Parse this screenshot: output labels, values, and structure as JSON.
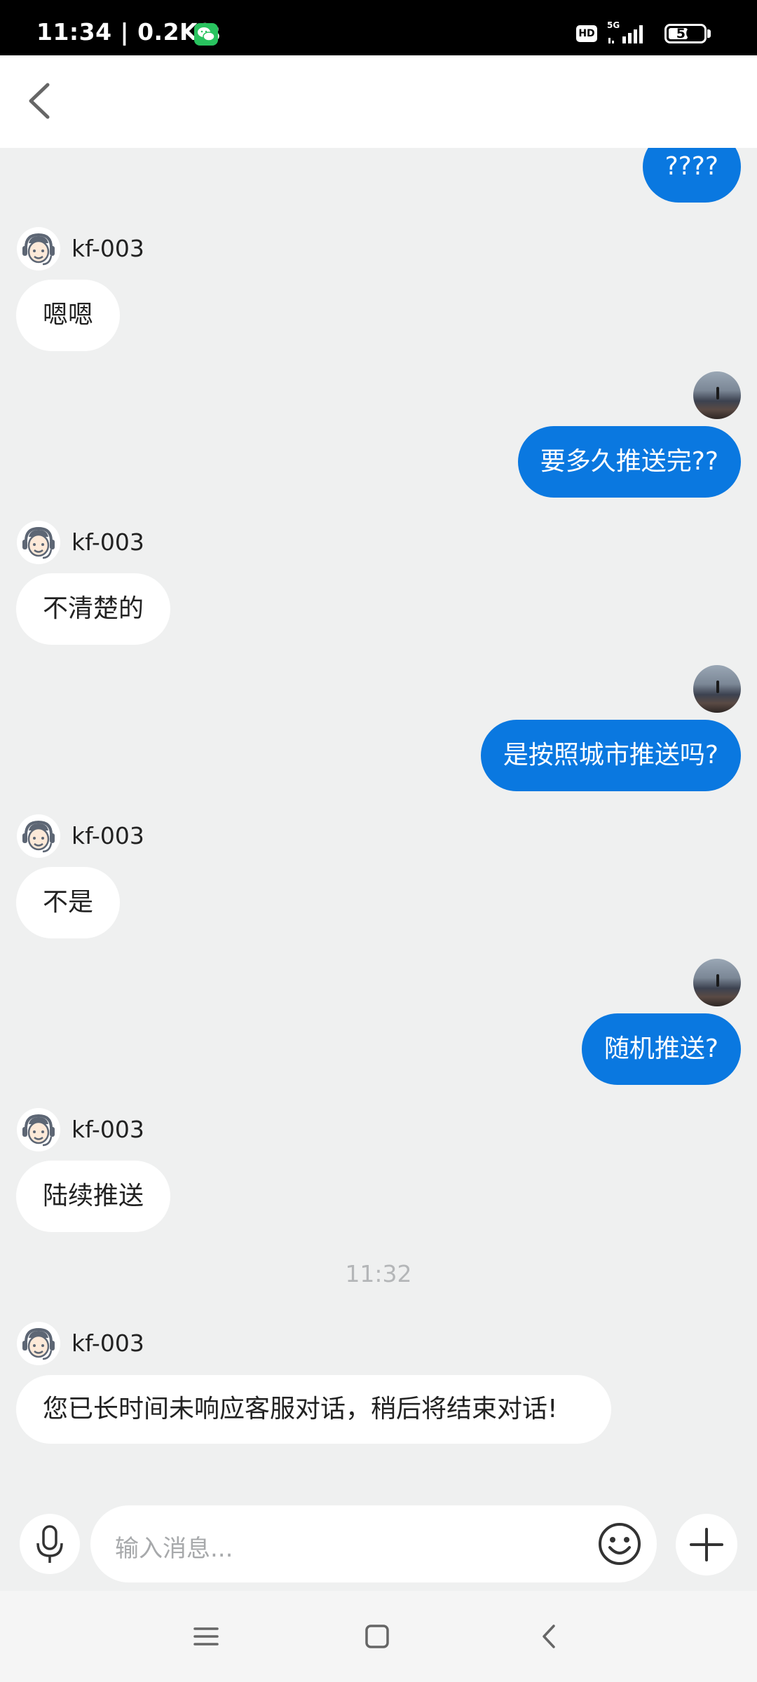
{
  "status_bar": {
    "time_speed": "11:34 | 0.2K/s",
    "hd_label": "HD",
    "network_label": "5G",
    "battery_level": "56",
    "battery_percent": 56
  },
  "header": {
    "back_icon": "chevron-left-icon"
  },
  "messages": [
    {
      "side": "right",
      "text": "????"
    },
    {
      "side": "left",
      "agent": "kf-003",
      "text": "嗯嗯"
    },
    {
      "side": "right",
      "text": "要多久推送完??"
    },
    {
      "side": "left",
      "agent": "kf-003",
      "text": "不清楚的"
    },
    {
      "side": "right",
      "text": "是按照城市推送吗?"
    },
    {
      "side": "left",
      "agent": "kf-003",
      "text": "不是"
    },
    {
      "side": "right",
      "text": "随机推送?"
    },
    {
      "side": "left",
      "agent": "kf-003",
      "text": "陆续推送"
    },
    {
      "type": "timestamp",
      "text": "11:32"
    },
    {
      "side": "left",
      "agent": "kf-003",
      "text": "您已长时间未响应客服对话，稍后将结束对话!"
    }
  ],
  "input_bar": {
    "placeholder": "输入消息...",
    "mic_icon": "microphone-icon",
    "emoji_icon": "smiley-icon",
    "plus_icon": "plus-icon"
  },
  "nav_bar": {
    "menu_icon": "menu-icon",
    "home_icon": "square-home-icon",
    "back_icon": "triangle-back-icon"
  },
  "colors": {
    "user_bubble": "#0a78e0",
    "agent_bubble": "#ffffff",
    "background": "#eff0f0",
    "wechat_green": "#29c35f"
  }
}
